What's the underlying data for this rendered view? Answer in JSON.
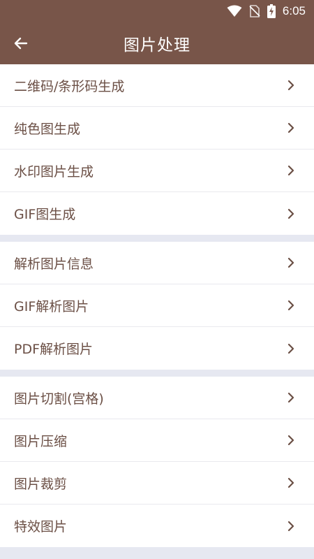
{
  "status": {
    "time": "6:05",
    "icons": [
      "wifi-icon",
      "no-sim-icon",
      "battery-charging-icon"
    ]
  },
  "appbar": {
    "title": "图片处理",
    "back_icon": "arrow-left-icon"
  },
  "groups": [
    {
      "items": [
        {
          "label": "二维码/条形码生成"
        },
        {
          "label": "纯色图生成"
        },
        {
          "label": "水印图片生成"
        },
        {
          "label": "GIF图生成"
        }
      ]
    },
    {
      "items": [
        {
          "label": "解析图片信息"
        },
        {
          "label": "GIF解析图片"
        },
        {
          "label": "PDF解析图片"
        }
      ]
    },
    {
      "items": [
        {
          "label": "图片切割(宫格)"
        },
        {
          "label": "图片压缩"
        },
        {
          "label": "图片裁剪"
        },
        {
          "label": "特效图片"
        }
      ]
    }
  ],
  "colors": {
    "primary": "#785549",
    "text": "#6b4f45",
    "background": "#e6e8f1"
  }
}
